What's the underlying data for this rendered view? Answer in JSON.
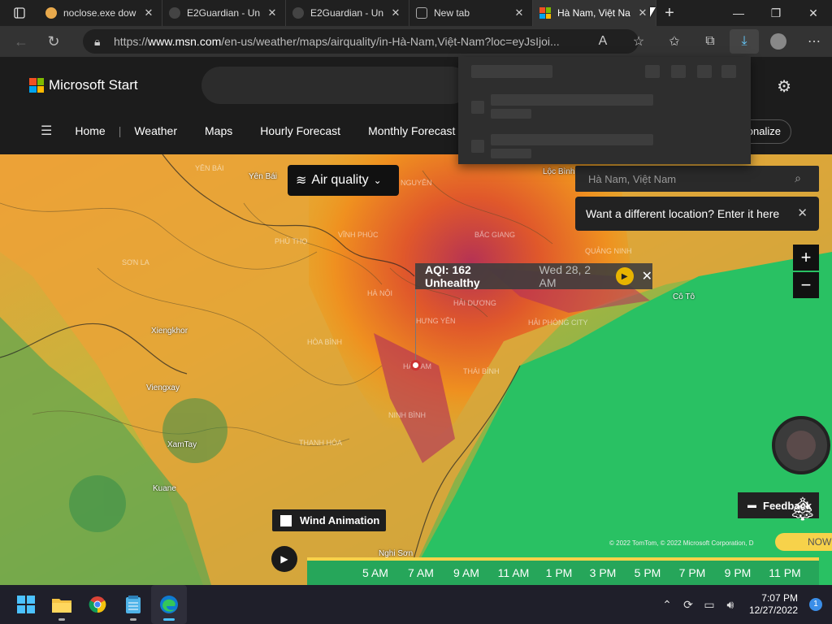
{
  "tabs": [
    {
      "title": "noclose.exe dow",
      "favicon_color": "#e8a94c"
    },
    {
      "title": "E2Guardian - Un",
      "favicon_color": "#444444"
    },
    {
      "title": "E2Guardian - Un",
      "favicon_color": "#444444"
    },
    {
      "title": "New tab",
      "favicon_color": "#3a3a3a"
    },
    {
      "title": "Hà Nam, Việt Na",
      "favicon_color": "#f25022",
      "active": true
    }
  ],
  "address": {
    "prefix": "https://",
    "host": "www.msn.com",
    "path": "/en-us/weather/maps/airquality/in-Hà-Nam,Việt-Nam?loc=eyJsIjoi..."
  },
  "site": {
    "brand": "Microsoft Start",
    "nav": [
      "Home",
      "Weather",
      "Maps",
      "Hourly Forecast",
      "Monthly Forecast"
    ],
    "personalize_label": "onalize"
  },
  "map": {
    "layer_button": "Air quality",
    "location_placeholder": "Hà Nam, Việt Nam",
    "location_tip": "Want a different location? Enter it here",
    "aqi_value": "AQI: 162 Unhealthy",
    "aqi_date": "Wed 28, 2 AM",
    "wind_label": "Wind Animation",
    "feedback_label": "Feedback",
    "copyright": "© 2022 TomTom, © 2022 Microsoft Corporation, D",
    "now_label": "NOW",
    "cities": [
      {
        "name": "Yên Bái",
        "faded": false
      },
      {
        "name": "YÊN BÁI",
        "faded": true
      },
      {
        "name": "THÁI NGUYÊN",
        "faded": true
      },
      {
        "name": "Lộc Bình",
        "faded": false
      },
      {
        "name": "PHÚ THỌ",
        "faded": true
      },
      {
        "name": "VĨNH PHÚC",
        "faded": true
      },
      {
        "name": "BẮC GIANG",
        "faded": true
      },
      {
        "name": "SƠN LA",
        "faded": true
      },
      {
        "name": "QUẢNG NINH",
        "faded": true
      },
      {
        "name": "HÀ NỘI",
        "faded": true
      },
      {
        "name": "HẢI DƯƠNG",
        "faded": true
      },
      {
        "name": "Cô Tô",
        "faded": false
      },
      {
        "name": "Xiengkhor",
        "faded": false
      },
      {
        "name": "HƯNG YÊN",
        "faded": true
      },
      {
        "name": "HẢI PHÒNG CITY",
        "faded": true
      },
      {
        "name": "HÒA BÌNH",
        "faded": true
      },
      {
        "name": "HÀ NAM",
        "faded": true
      },
      {
        "name": "THÁI BÌNH",
        "faded": true
      },
      {
        "name": "Viengxay",
        "faded": false
      },
      {
        "name": "NINH BÌNH",
        "faded": true
      },
      {
        "name": "XamTay",
        "faded": false
      },
      {
        "name": "THANH HÓA",
        "faded": true
      },
      {
        "name": "Kuane",
        "faded": false
      },
      {
        "name": "Nghi Sơn",
        "faded": false
      }
    ],
    "timeline": [
      "5 AM",
      "7 AM",
      "9 AM",
      "11 AM",
      "1 PM",
      "3 PM",
      "5 PM",
      "7 PM",
      "9 PM",
      "11 PM"
    ]
  },
  "taskbar": {
    "time": "7:07 PM",
    "date": "12/27/2022",
    "notifications": "1"
  }
}
